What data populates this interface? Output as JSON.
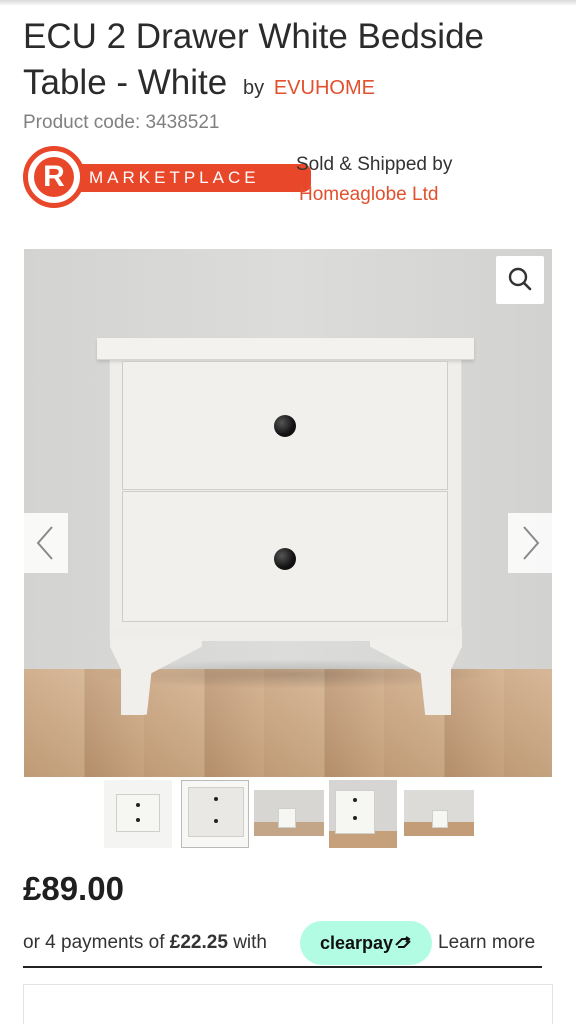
{
  "product": {
    "title": "ECU 2 Drawer White Bedside Table - White",
    "by_label": "by",
    "brand": "EVUHOME",
    "product_code": "Product code: 3438521"
  },
  "marketplace": {
    "logo_letter": "R",
    "logo_text": "MARKETPLACE",
    "sold_label": "Sold & Shipped by",
    "seller": "Homeaglobe Ltd",
    "brand_color": "#e9472a"
  },
  "gallery": {
    "zoom_icon": "magnifier-icon",
    "prev_icon": "chevron-left-icon",
    "next_icon": "chevron-right-icon",
    "thumbnail_count": 5,
    "selected_thumbnail": 2
  },
  "pricing": {
    "price": "£89.00",
    "payments_prefix": "or 4 payments of ",
    "payments_amount": "£22.25",
    "payments_suffix": " with",
    "clearpay_label": "clearpay",
    "learn_more": "Learn more",
    "clearpay_color": "#b2fce4"
  }
}
